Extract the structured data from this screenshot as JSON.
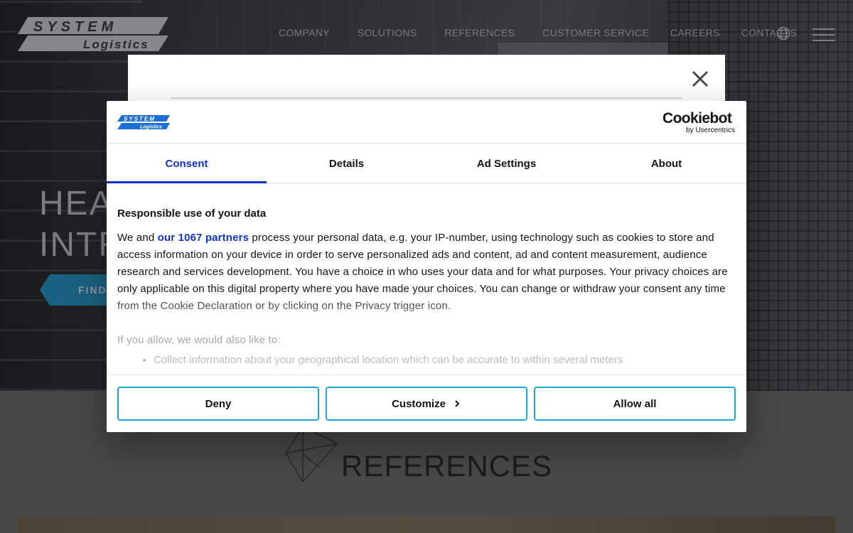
{
  "site": {
    "logo_text": [
      "SYSTEM",
      "Logistics"
    ],
    "nav": [
      "COMPANY",
      "SOLUTIONS",
      "REFERENCES",
      "CUSTOMER SERVICE",
      "CAREERS",
      "CONTACTS"
    ],
    "hero_title_lines": [
      "HEA",
      "INTR"
    ],
    "hero_button": "FIND",
    "references_heading": "REFERENCES"
  },
  "cookie_banner": {
    "brand": {
      "main": "Cookiebot",
      "sub": "by Usercentrics"
    },
    "tabs": [
      "Consent",
      "Details",
      "Ad Settings",
      "About"
    ],
    "active_tab": "Consent",
    "heading": "Responsible use of your data",
    "body_pre": "We and ",
    "partners_link": "our 1067 partners",
    "body_post": " process your personal data, e.g. your IP-number, using technology such as cookies to store and access information on your device in order to serve personalized ads and content, ad and content measurement, audience research and services development. You have a choice in who uses your data and for what purposes. Your privacy choices are only applicable on this digital property where you have made your choices. You can change or withdraw your consent any time from the Cookie Declaration or by clicking on the Privacy trigger icon.",
    "also_text": "If you allow, we would also like to:",
    "also_items": [
      "Collect information about your geographical location which can be accurate to within several meters"
    ],
    "buttons": {
      "deny": "Deny",
      "customize": "Customize",
      "allow": "Allow all"
    }
  },
  "colors": {
    "accent_blue": "#1032cf",
    "button_border": "#1aa7d6",
    "hero_button": "#2a9fd1"
  },
  "icons": [
    "globe-icon",
    "menu-icon",
    "close-icon",
    "chevron-right-icon",
    "references-cube-icon"
  ]
}
